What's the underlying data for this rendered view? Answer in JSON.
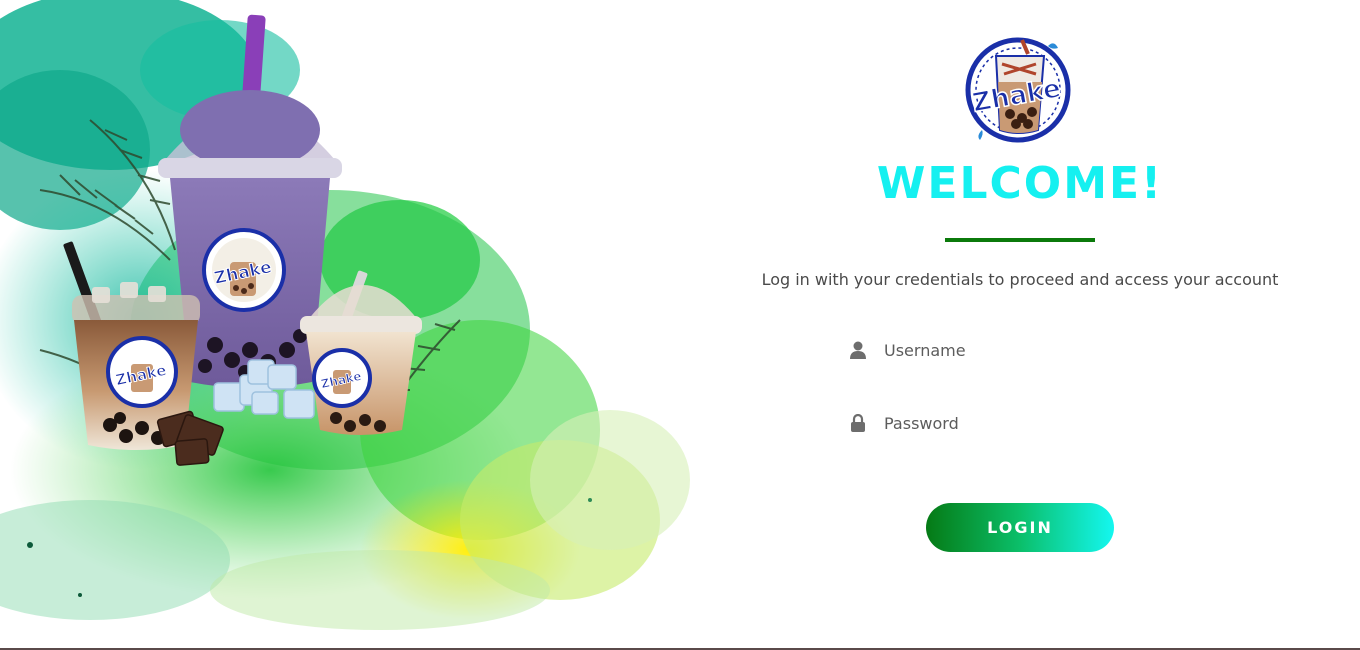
{
  "brand": {
    "logo_text": "Zhake",
    "colors": {
      "accent_cyan": "#15f0f0",
      "accent_green": "#0b7a0b",
      "brand_blue": "#1a2fa8"
    }
  },
  "login": {
    "heading": "WELCOME!",
    "subtitle": "Log in with your credentials to proceed and access your account",
    "username": {
      "icon": "user-icon",
      "placeholder": "Username",
      "value": ""
    },
    "password": {
      "icon": "lock-icon",
      "placeholder": "Password",
      "value": ""
    },
    "submit_label": "LOGIN"
  },
  "hero": {
    "cup_logo_text": "Zhake"
  }
}
